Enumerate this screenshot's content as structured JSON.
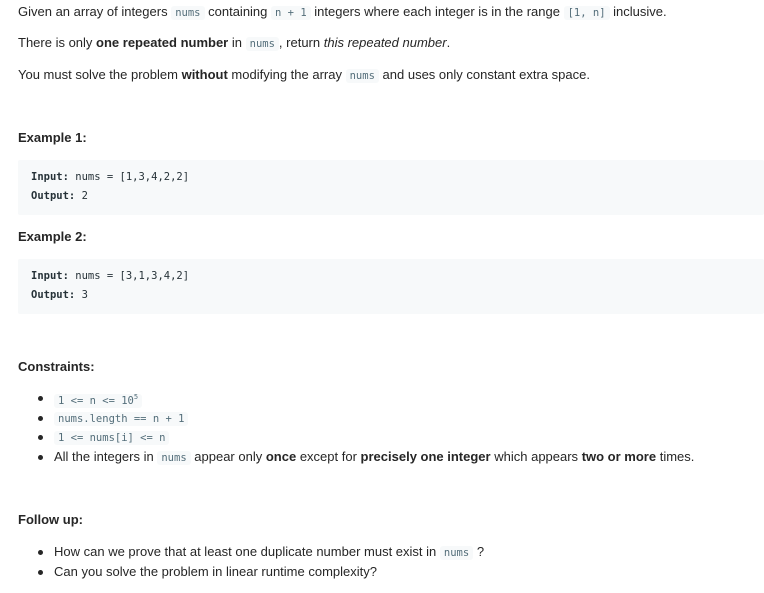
{
  "intro": {
    "p1": {
      "t1": "Given an array of integers",
      "c1": "nums",
      "t2": "containing",
      "c2": "n + 1",
      "t3": "integers where each integer is in the range",
      "c3": "[1, n]",
      "t4": "inclusive."
    },
    "p2": {
      "t1": "There is only",
      "b1": "one repeated number",
      "t2": "in",
      "c1": "nums",
      "t3": ", return",
      "i1": "this repeated number",
      "t4": "."
    },
    "p3": {
      "t1": "You must solve the problem",
      "b1": "without",
      "t2": "modifying the array",
      "c1": "nums",
      "t3": "and uses only constant extra space."
    }
  },
  "examples": [
    {
      "title": "Example 1:",
      "input_label": "Input:",
      "input_value": "nums = [1,3,4,2,2]",
      "output_label": "Output:",
      "output_value": "2"
    },
    {
      "title": "Example 2:",
      "input_label": "Input:",
      "input_value": "nums = [3,1,3,4,2]",
      "output_label": "Output:",
      "output_value": "3"
    }
  ],
  "constraints": {
    "title": "Constraints:",
    "c1_base": "1 <= n <= 10",
    "c1_sup": "5",
    "c2": "nums.length == n + 1",
    "c3": "1 <= nums[i] <= n",
    "c4": {
      "t1": "All the integers in",
      "c1": "nums",
      "t2": "appear only",
      "b1": "once",
      "t3": "except for",
      "b2": "precisely one integer",
      "t4": "which appears",
      "b3": "two or more",
      "t5": "times."
    }
  },
  "followup": {
    "title": "Follow up:",
    "q1_text": "How can we prove that at least one duplicate number must exist in",
    "q1_code": "nums",
    "q1_end": "?",
    "q2": "Can you solve the problem in linear runtime complexity?"
  }
}
